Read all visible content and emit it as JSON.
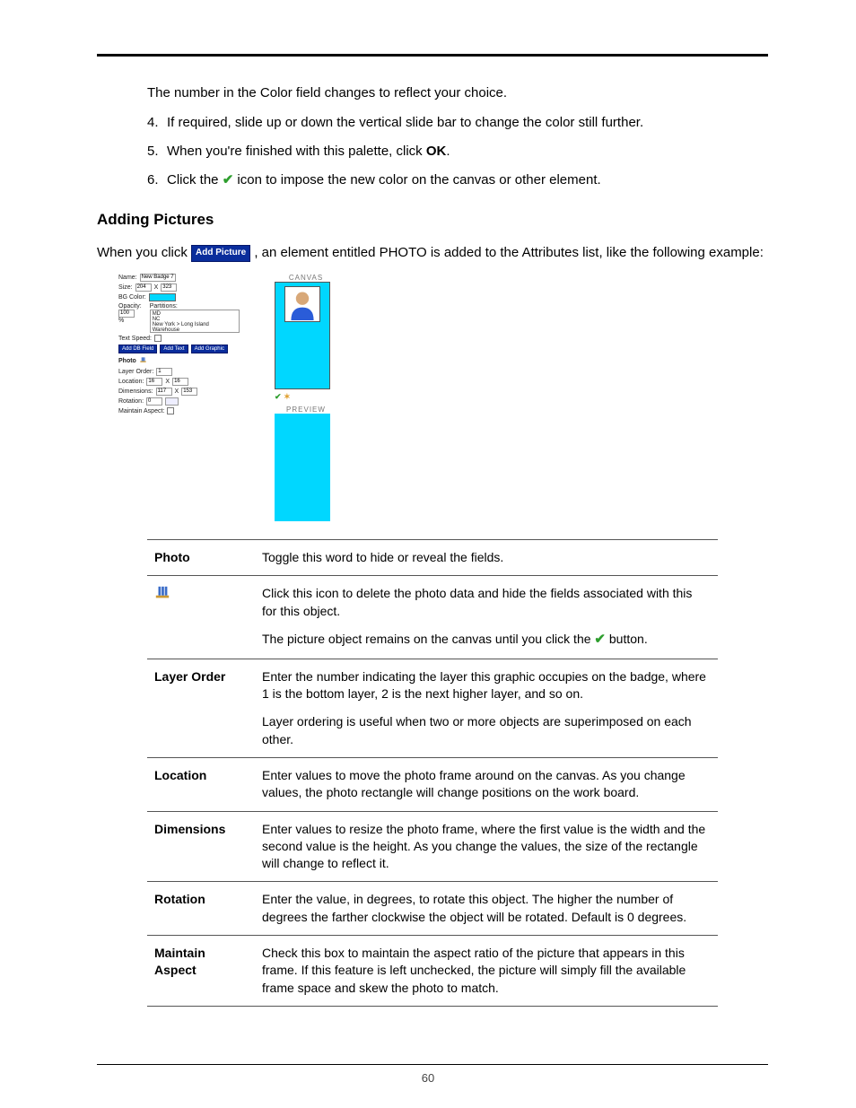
{
  "intro_line": "The number in the Color field changes to reflect your choice.",
  "steps": [
    {
      "num": "4.",
      "text_before": "If required, slide up or down the vertical slide bar to change the color still further."
    },
    {
      "num": "5.",
      "text_before": "When you're finished with this palette, click ",
      "bold": "OK",
      "text_after": "."
    },
    {
      "num": "6.",
      "text_before": "Click the ",
      "icon": "check",
      "text_after": " icon to impose the new color on the canvas or other element."
    }
  ],
  "heading": "Adding Pictures",
  "body_before": "When you click ",
  "addpic_label": "Add Picture",
  "body_after": ", an element entitled PHOTO is added to the Attributes list, like the following example:",
  "mock": {
    "name_label": "Name:",
    "name_value": "New Badge 7",
    "size_label": "Size:",
    "size_w": "204",
    "size_h": "323",
    "x_sep": "X",
    "bgcolor_label": "BG Color:",
    "opacity_label": "Opacity:",
    "opacity_value": "100",
    "opacity_pct": "%",
    "partitions_label": "Partitions:",
    "partitions_lines": [
      "MD",
      "NC",
      "New York > Long Island Warehouse"
    ],
    "textspeed_label": "Text Speed:",
    "buttons": [
      "Add DB Field",
      "Add Text",
      "Add Graphic"
    ],
    "photo_label": "Photo",
    "layer_label": "Layer Order:",
    "layer_value": "1",
    "loc_label": "Location:",
    "loc_x": "16",
    "loc_y": "16",
    "dim_label": "Dimensions:",
    "dim_w": "117",
    "dim_h": "153",
    "rot_label": "Rotation:",
    "rot_value": "0",
    "maintain_label": "Maintain Aspect:",
    "canvas_title": "CANVAS",
    "preview_title": "PREVIEW"
  },
  "table": [
    {
      "label": "Photo",
      "paras": [
        "Toggle this word to hide or reveal the fields."
      ]
    },
    {
      "label_icon": "delete",
      "paras": [
        "Click this icon to delete the photo data and hide the fields associated with this for this object.",
        {
          "before": "The picture object remains on the canvas until you click the ",
          "icon": "check",
          "after": " button."
        }
      ]
    },
    {
      "label": "Layer Order",
      "paras": [
        "Enter the number indicating the layer this graphic occupies on the badge, where 1 is the bottom layer, 2 is the next higher layer, and so on.",
        "Layer ordering is useful when two or more objects are superimposed on each other."
      ]
    },
    {
      "label": "Location",
      "paras": [
        "Enter values to move the photo frame around on the canvas. As you change values, the photo rectangle will change positions on the work board."
      ]
    },
    {
      "label": "Dimensions",
      "paras": [
        "Enter values to resize the photo frame, where the first value is the width and the second value is the height. As you change the values, the size of the rectangle will change to reflect it."
      ]
    },
    {
      "label": "Rotation",
      "paras": [
        "Enter the value, in degrees, to rotate this object. The higher the number of degrees the farther clockwise the object will be rotated. Default is 0 degrees."
      ]
    },
    {
      "label": "Maintain Aspect",
      "paras": [
        "Check this box to maintain the aspect ratio of the picture that appears in this frame. If this feature is left unchecked, the picture will simply fill the available frame space and skew the photo to match."
      ]
    }
  ],
  "page_number": "60"
}
